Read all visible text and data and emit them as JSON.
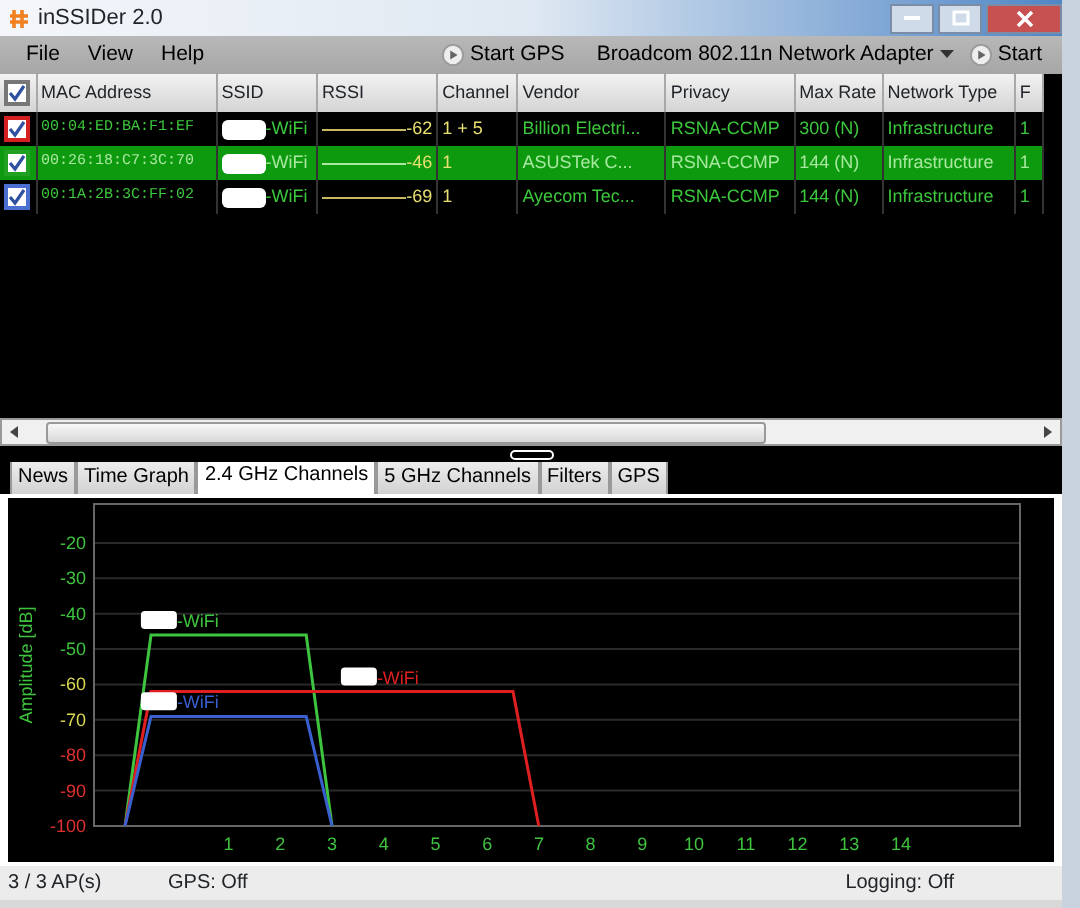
{
  "window": {
    "title": "inSSIDer 2.0"
  },
  "menu": [
    "File",
    "View",
    "Help"
  ],
  "toolbar": {
    "gps_button": "Start GPS",
    "adapter": "Broadcom 802.11n Network Adapter",
    "start_button": "Start"
  },
  "table": {
    "all_checked": true,
    "columns": [
      "MAC Address",
      "SSID",
      "RSSI",
      "Channel",
      "Vendor",
      "Privacy",
      "Max Rate",
      "Network Type",
      "F"
    ],
    "rows": [
      {
        "checked": true,
        "selected": false,
        "color": "#d42020",
        "mac": "00:04:ED:BA:F1:EF",
        "ssid": "-WiFi",
        "rssi": "-62",
        "channel": "1 + 5",
        "vendor": "Billion Electri...",
        "privacy": "RSNA-CCMP",
        "max_rate": "300 (N)",
        "network_type": "Infrastructure",
        "column_10": "1"
      },
      {
        "checked": true,
        "selected": true,
        "color": "#22a022",
        "mac": "00:26:18:C7:3C:70",
        "ssid": "-WiFi",
        "rssi": "-46",
        "channel": "1",
        "vendor": "ASUSTek C...",
        "privacy": "RSNA-CCMP",
        "max_rate": "144 (N)",
        "network_type": "Infrastructure",
        "column_10": "1"
      },
      {
        "checked": true,
        "selected": false,
        "color": "#4a6fd0",
        "mac": "00:1A:2B:3C:FF:02",
        "ssid": "-WiFi",
        "rssi": "-69",
        "channel": "1",
        "vendor": "Ayecom Tec...",
        "privacy": "RSNA-CCMP",
        "max_rate": "144 (N)",
        "network_type": "Infrastructure",
        "column_10": "1"
      }
    ]
  },
  "tabs": [
    {
      "label": "News",
      "selected": false
    },
    {
      "label": "Time Graph",
      "selected": false
    },
    {
      "label": "2.4 GHz Channels",
      "selected": true
    },
    {
      "label": "5 GHz Channels",
      "selected": false
    },
    {
      "label": "Filters",
      "selected": false
    },
    {
      "label": "GPS",
      "selected": false
    }
  ],
  "channels_panel": {
    "chart_data": {
      "type": "line",
      "grid": true,
      "ylabel": "Amplitude [dB]",
      "x": [
        -1,
        -0.5,
        2.5,
        3,
        6.5,
        7
      ],
      "xlim": [
        -1.6,
        16.3
      ],
      "ylim": [
        -100,
        -9
      ],
      "xticks": [
        {
          "value": 1,
          "label": "1"
        },
        {
          "value": 2,
          "label": "2"
        },
        {
          "value": 3,
          "label": "3"
        },
        {
          "value": 4,
          "label": "4"
        },
        {
          "value": 5,
          "label": "5"
        },
        {
          "value": 6,
          "label": "6"
        },
        {
          "value": 7,
          "label": "7"
        },
        {
          "value": 8,
          "label": "8"
        },
        {
          "value": 9,
          "label": "9"
        },
        {
          "value": 10,
          "label": "10"
        },
        {
          "value": 11,
          "label": "11"
        },
        {
          "value": 12,
          "label": "12"
        },
        {
          "value": 13,
          "label": "13"
        },
        {
          "value": 14,
          "label": "14"
        }
      ],
      "yticks": [
        -20,
        -30,
        -40,
        -50,
        -60,
        -70,
        -80,
        -90,
        -100
      ],
      "series": [
        {
          "name": "-WiFi",
          "color": "#3ec43e",
          "values": [
            -100,
            -46,
            -46,
            -100,
            null,
            null
          ]
        },
        {
          "name": "-WiFi",
          "color": "#e02020",
          "values": [
            -100,
            -62,
            -62,
            -62,
            -62,
            -100
          ]
        },
        {
          "name": "-WiFi",
          "color": "#3a5fd0",
          "values": [
            -100,
            -69,
            -69,
            -100,
            null,
            null
          ]
        }
      ]
    }
  },
  "status_bar": {
    "aps": "3 / 3 AP(s)",
    "gps": "GPS: Off",
    "logging": "Logging: Off"
  }
}
